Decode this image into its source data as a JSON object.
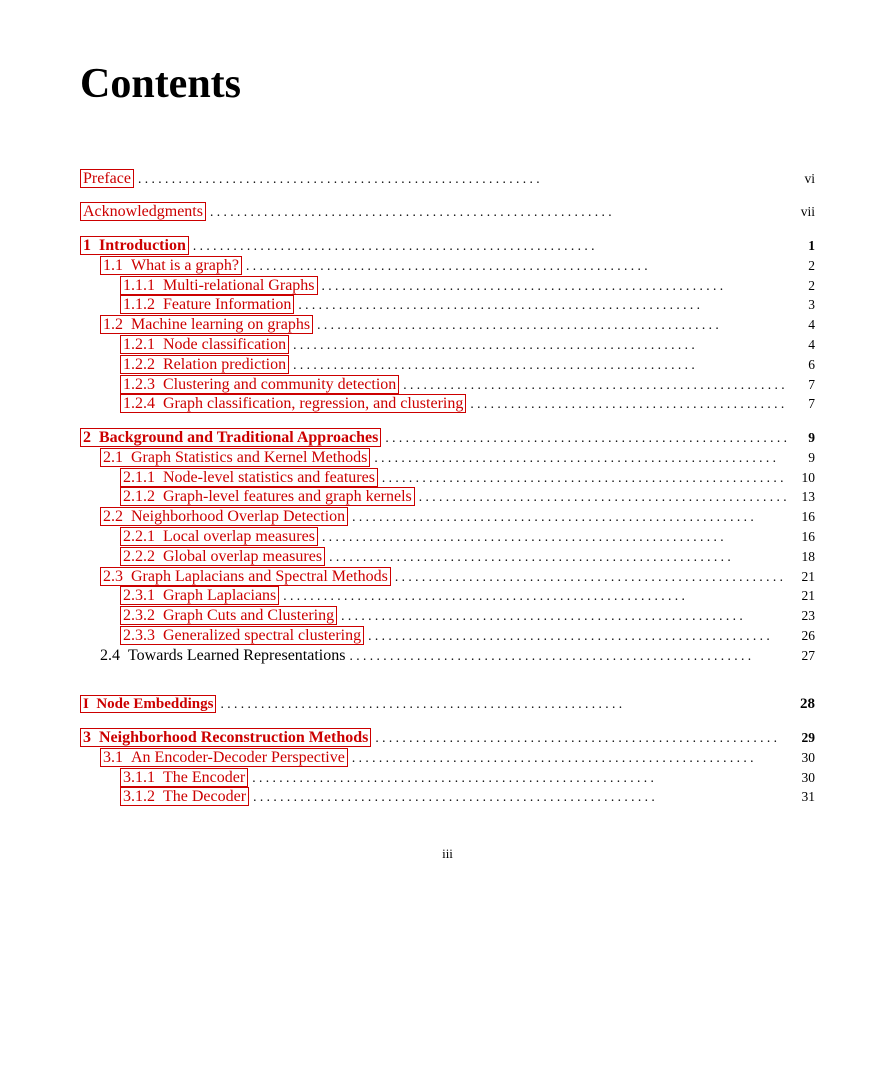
{
  "page": {
    "title": "Contents",
    "footer": "iii"
  },
  "entries": [
    {
      "id": "preface",
      "indent": 0,
      "label": "Preface",
      "label_prefix": "",
      "linked": true,
      "page": "vi",
      "bold": false,
      "part": false,
      "spacer_before": "lg"
    },
    {
      "id": "acknowledgments",
      "indent": 0,
      "label": "Acknowledgments",
      "label_prefix": "",
      "linked": true,
      "page": "vii",
      "bold": false,
      "part": false,
      "spacer_before": "sm"
    },
    {
      "id": "ch1",
      "indent": 0,
      "label": "Introduction",
      "label_prefix": "1",
      "linked": true,
      "page": "1",
      "bold": true,
      "part": false,
      "spacer_before": "sm"
    },
    {
      "id": "s1.1",
      "indent": 1,
      "label": "What is a graph?",
      "label_prefix": "1.1",
      "linked": true,
      "page": "2",
      "bold": false,
      "part": false,
      "spacer_before": "none"
    },
    {
      "id": "s1.1.1",
      "indent": 2,
      "label": "Multi-relational Graphs",
      "label_prefix": "1.1.1",
      "linked": true,
      "page": "2",
      "bold": false,
      "part": false,
      "spacer_before": "none"
    },
    {
      "id": "s1.1.2",
      "indent": 2,
      "label": "Feature Information",
      "label_prefix": "1.1.2",
      "linked": true,
      "page": "3",
      "bold": false,
      "part": false,
      "spacer_before": "none"
    },
    {
      "id": "s1.2",
      "indent": 1,
      "label": "Machine learning on graphs",
      "label_prefix": "1.2",
      "linked": true,
      "page": "4",
      "bold": false,
      "part": false,
      "spacer_before": "none"
    },
    {
      "id": "s1.2.1",
      "indent": 2,
      "label": "Node classification",
      "label_prefix": "1.2.1",
      "linked": true,
      "page": "4",
      "bold": false,
      "part": false,
      "spacer_before": "none"
    },
    {
      "id": "s1.2.2",
      "indent": 2,
      "label": "Relation prediction",
      "label_prefix": "1.2.2",
      "linked": true,
      "page": "6",
      "bold": false,
      "part": false,
      "spacer_before": "none"
    },
    {
      "id": "s1.2.3",
      "indent": 2,
      "label": "Clustering and community detection",
      "label_prefix": "1.2.3",
      "linked": true,
      "page": "7",
      "bold": false,
      "part": false,
      "spacer_before": "none"
    },
    {
      "id": "s1.2.4",
      "indent": 2,
      "label": "Graph classification, regression, and clustering",
      "label_prefix": "1.2.4",
      "linked": true,
      "page": "7",
      "bold": false,
      "part": false,
      "spacer_before": "none"
    },
    {
      "id": "ch2",
      "indent": 0,
      "label": "Background and Traditional Approaches",
      "label_prefix": "2",
      "linked": true,
      "page": "9",
      "bold": true,
      "part": false,
      "spacer_before": "sm"
    },
    {
      "id": "s2.1",
      "indent": 1,
      "label": "Graph Statistics and Kernel Methods",
      "label_prefix": "2.1",
      "linked": true,
      "page": "9",
      "bold": false,
      "part": false,
      "spacer_before": "none"
    },
    {
      "id": "s2.1.1",
      "indent": 2,
      "label": "Node-level statistics and features",
      "label_prefix": "2.1.1",
      "linked": true,
      "page": "10",
      "bold": false,
      "part": false,
      "spacer_before": "none"
    },
    {
      "id": "s2.1.2",
      "indent": 2,
      "label": "Graph-level features and graph kernels",
      "label_prefix": "2.1.2",
      "linked": true,
      "page": "13",
      "bold": false,
      "part": false,
      "spacer_before": "none"
    },
    {
      "id": "s2.2",
      "indent": 1,
      "label": "Neighborhood Overlap Detection",
      "label_prefix": "2.2",
      "linked": true,
      "page": "16",
      "bold": false,
      "part": false,
      "spacer_before": "none"
    },
    {
      "id": "s2.2.1",
      "indent": 2,
      "label": "Local overlap measures",
      "label_prefix": "2.2.1",
      "linked": true,
      "page": "16",
      "bold": false,
      "part": false,
      "spacer_before": "none"
    },
    {
      "id": "s2.2.2",
      "indent": 2,
      "label": "Global overlap measures",
      "label_prefix": "2.2.2",
      "linked": true,
      "page": "18",
      "bold": false,
      "part": false,
      "spacer_before": "none"
    },
    {
      "id": "s2.3",
      "indent": 1,
      "label": "Graph Laplacians and Spectral Methods",
      "label_prefix": "2.3",
      "linked": true,
      "page": "21",
      "bold": false,
      "part": false,
      "spacer_before": "none"
    },
    {
      "id": "s2.3.1",
      "indent": 2,
      "label": "Graph Laplacians",
      "label_prefix": "2.3.1",
      "linked": true,
      "page": "21",
      "bold": false,
      "part": false,
      "spacer_before": "none"
    },
    {
      "id": "s2.3.2",
      "indent": 2,
      "label": "Graph Cuts and Clustering",
      "label_prefix": "2.3.2",
      "linked": true,
      "page": "23",
      "bold": false,
      "part": false,
      "spacer_before": "none"
    },
    {
      "id": "s2.3.3",
      "indent": 2,
      "label": "Generalized spectral clustering",
      "label_prefix": "2.3.3",
      "linked": true,
      "page": "26",
      "bold": false,
      "part": false,
      "spacer_before": "none"
    },
    {
      "id": "s2.4",
      "indent": 1,
      "label": "Towards Learned Representations",
      "label_prefix": "2.4",
      "linked": false,
      "page": "27",
      "bold": false,
      "part": false,
      "spacer_before": "none"
    },
    {
      "id": "part1",
      "indent": 0,
      "label": "Node Embeddings",
      "label_prefix": "I",
      "linked": true,
      "page": "28",
      "bold": true,
      "part": true,
      "spacer_before": "xl"
    },
    {
      "id": "ch3",
      "indent": 0,
      "label": "Neighborhood Reconstruction Methods",
      "label_prefix": "3",
      "linked": true,
      "page": "29",
      "bold": true,
      "part": false,
      "spacer_before": "sm"
    },
    {
      "id": "s3.1",
      "indent": 1,
      "label": "An Encoder-Decoder Perspective",
      "label_prefix": "3.1",
      "linked": true,
      "page": "30",
      "bold": false,
      "part": false,
      "spacer_before": "none"
    },
    {
      "id": "s3.1.1",
      "indent": 2,
      "label": "The Encoder",
      "label_prefix": "3.1.1",
      "linked": true,
      "page": "30",
      "bold": false,
      "part": false,
      "spacer_before": "none"
    },
    {
      "id": "s3.1.2",
      "indent": 2,
      "label": "The Decoder",
      "label_prefix": "3.1.2",
      "linked": true,
      "page": "31",
      "bold": false,
      "part": false,
      "spacer_before": "none"
    }
  ]
}
